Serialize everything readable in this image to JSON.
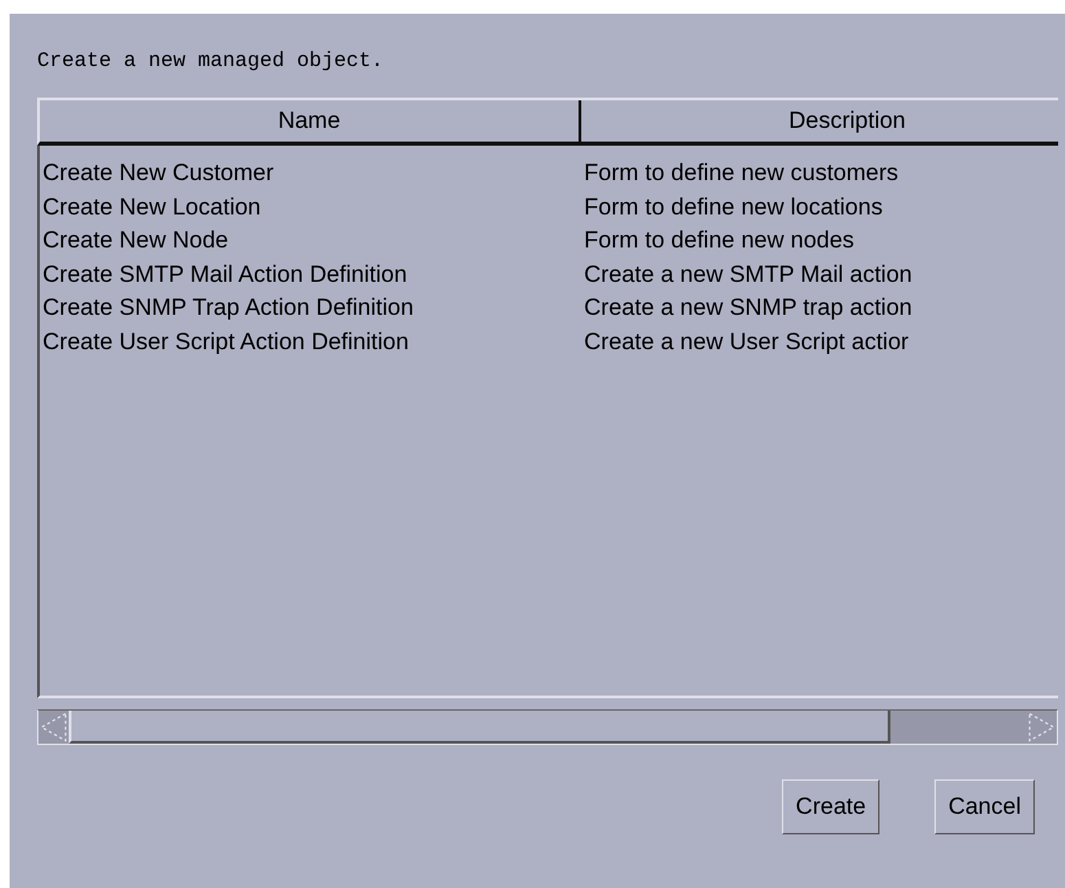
{
  "prompt": "Create a new managed object.",
  "table": {
    "columns": [
      "Name",
      "Description"
    ],
    "rows": [
      {
        "name": "Create New Customer",
        "description": "Form to define new customers"
      },
      {
        "name": "Create New Location",
        "description": "Form to define new locations"
      },
      {
        "name": "Create New Node",
        "description": "Form to define new nodes"
      },
      {
        "name": "Create SMTP Mail Action Definition",
        "description": "Create a new SMTP Mail action"
      },
      {
        "name": "Create SNMP Trap Action Definition",
        "description": "Create a new SNMP trap action"
      },
      {
        "name": "Create User Script Action Definition",
        "description": "Create a new User Script actior"
      }
    ]
  },
  "buttons": [
    "Create",
    "Cancel"
  ]
}
